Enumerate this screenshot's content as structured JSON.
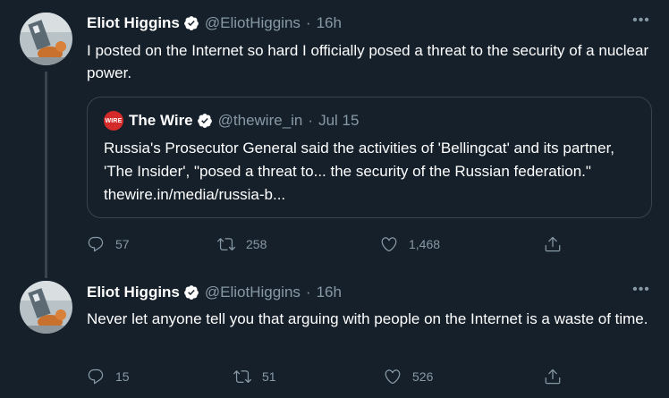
{
  "tweets": [
    {
      "author_name": "Eliot Higgins",
      "handle": "@EliotHiggins",
      "separator": "·",
      "time": "16h",
      "more": "•••",
      "text": "I posted on the Internet so hard I officially posed a threat to the security of a nuclear power.",
      "quote": {
        "logo_text": "WIRE",
        "author_name": "The Wire",
        "handle": "@thewire_in",
        "separator": "·",
        "time": "Jul 15",
        "text": "Russia's Prosecutor General said the activities of 'Bellingcat' and its partner, 'The Insider', \"posed a threat to... the security of the Russian federation.\" thewire.in/media/russia-b..."
      },
      "replies": "57",
      "retweets": "258",
      "likes": "1,468"
    },
    {
      "author_name": "Eliot Higgins",
      "handle": "@EliotHiggins",
      "separator": "·",
      "time": "16h",
      "more": "•••",
      "text": "Never let anyone tell you that arguing with people on the Internet is a waste of time.",
      "replies": "15",
      "retweets": "51",
      "likes": "526"
    }
  ],
  "colors": {
    "background": "#15202b",
    "secondary_text": "#8899a6",
    "border": "#38444d",
    "verified": "#ffffff",
    "wire_logo": "#d42a2a"
  },
  "icons": [
    "verified-badge-icon",
    "more-icon",
    "reply-icon",
    "retweet-icon",
    "like-icon",
    "share-icon"
  ]
}
